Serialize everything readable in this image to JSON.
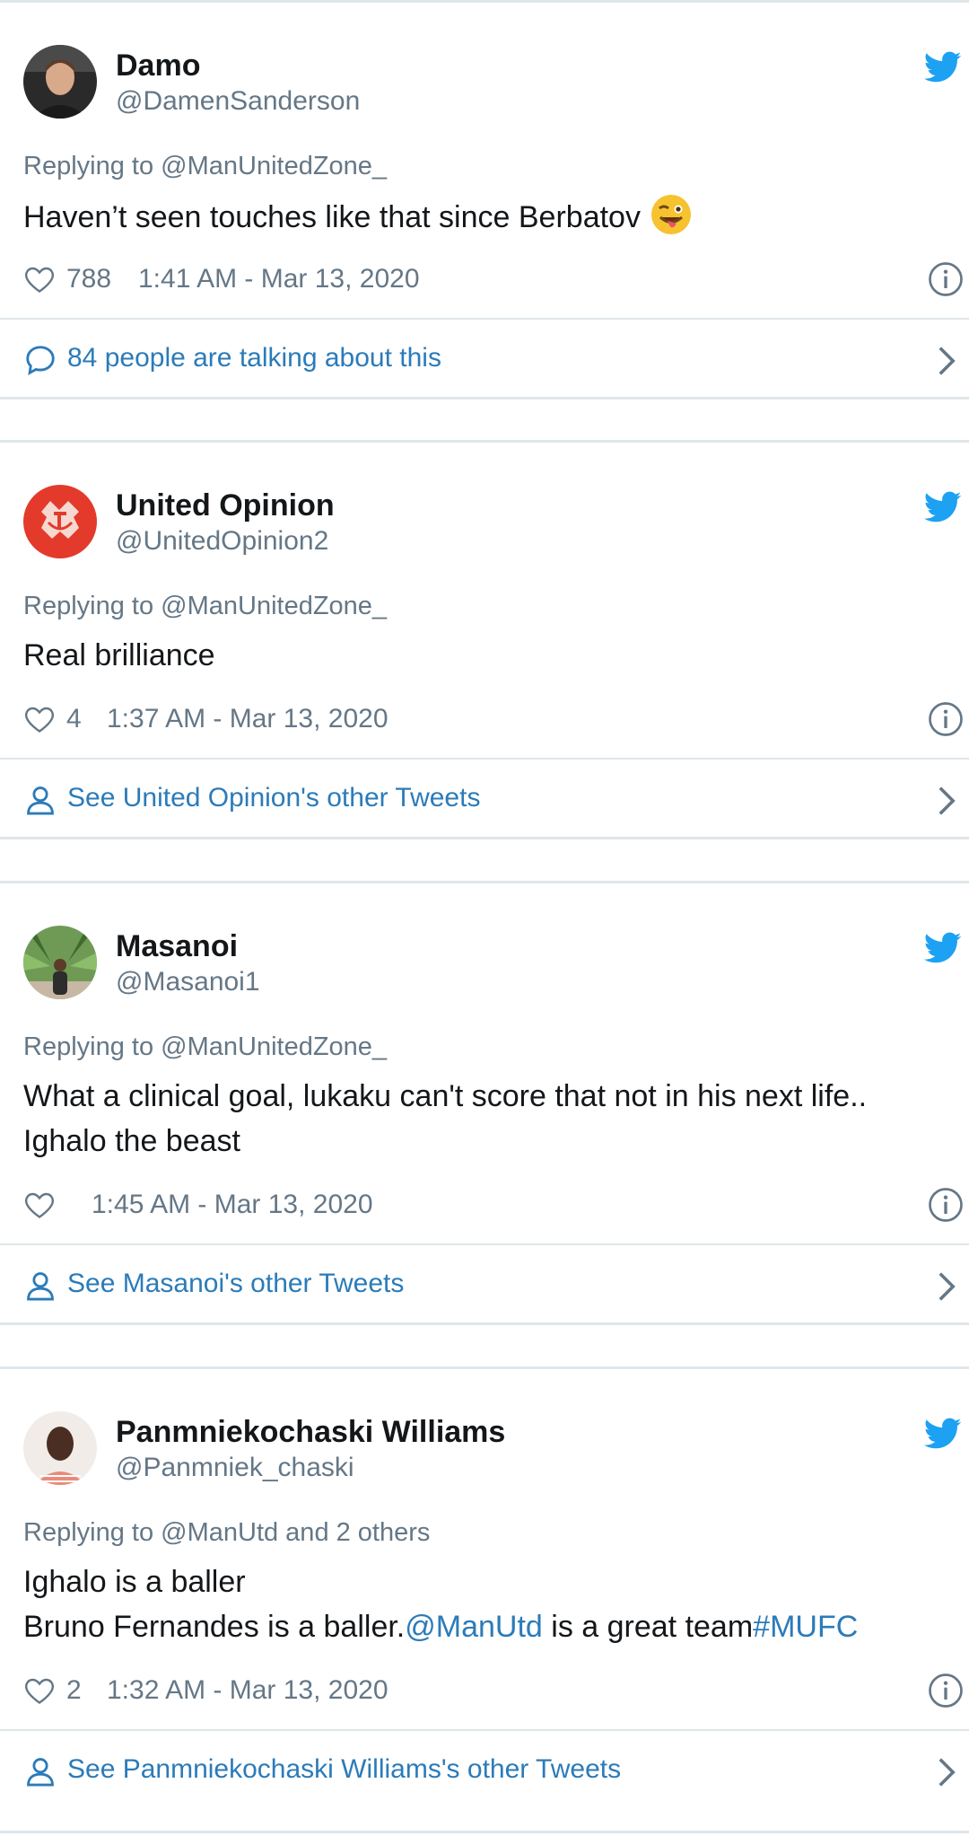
{
  "colors": {
    "link": "#2b7bb9",
    "secondary_text": "#657786",
    "primary_text": "#14171a",
    "twitter_blue": "#1da1f2",
    "divider": "#dfe6ea"
  },
  "tweets": [
    {
      "name": "Damo",
      "handle": "@DamenSanderson",
      "reply_to": "Replying to @ManUnitedZone_",
      "text_line1": "Haven’t seen touches like that since Berbatov",
      "emoji": "winking-face-with-tongue",
      "likes": "788",
      "time": "1:41 AM - Mar 13, 2020",
      "cta_icon": "speech-bubble-icon",
      "cta": "84 people are talking about this"
    },
    {
      "name": "United Opinion",
      "handle": "@UnitedOpinion2",
      "reply_to": "Replying to @ManUnitedZone_",
      "text_line1": "Real brilliance",
      "likes": "4",
      "time": "1:37 AM - Mar 13, 2020",
      "cta_icon": "person-icon",
      "cta": "See United Opinion's other Tweets"
    },
    {
      "name": "Masanoi",
      "handle": "@Masanoi1",
      "reply_to": "Replying to @ManUnitedZone_",
      "text_line1": "What a clinical goal, lukaku can't score that not in his next life..",
      "text_line2": "Ighalo the beast",
      "likes": "",
      "time": "1:45 AM - Mar 13, 2020",
      "cta_icon": "person-icon",
      "cta": "See Masanoi's other Tweets"
    },
    {
      "name": "Panmniekochaski Williams",
      "handle": "@Panmniek_chaski",
      "reply_to": "Replying to @ManUtd and 2 others",
      "text_line1": "Ighalo is a baller",
      "text_line2_a": "Bruno Fernandes is a baller.",
      "text_line2_mention": "@ManUtd",
      "text_line2_b": " is a great team",
      "text_line2_hashtag": "#MUFC",
      "likes": "2",
      "time": "1:32 AM - Mar 13, 2020",
      "cta_icon": "person-icon",
      "cta": "See Panmniekochaski Williams's other Tweets"
    }
  ]
}
